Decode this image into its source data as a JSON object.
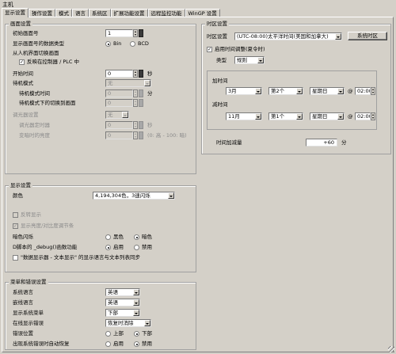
{
  "window_title": "主机",
  "tabs": [
    "显示设置",
    "操作设置",
    "模式",
    "语言",
    "系统区",
    "扩展功能设置",
    "远程监控功能",
    "WinGP 设置"
  ],
  "screen_settings": {
    "title": "画面设置",
    "initial_screen_label": "初始画面号",
    "initial_screen_value": "1",
    "data_type_label": "显示画面号的数据类型",
    "bin_label": "Bin",
    "bcd_label": "BCD",
    "data_type_selected": "Bin",
    "switch_from_hmi_label": "从人机界面切换画面",
    "reflect_label": "反映在控制器 / PLC 中",
    "reflect_checked": true,
    "start_time_label": "开始时间",
    "start_time_value": "0",
    "seconds_unit": "秒",
    "standby_label": "待机模式",
    "standby_value": "无",
    "standby_time_label": "待机模式时间",
    "standby_time_value": "0",
    "minutes_unit": "分",
    "standby_switch_label": "待机模式下的切换到画面",
    "standby_switch_value": "0",
    "dimmer_label": "调光器设置",
    "dimmer_value": "无",
    "dimmer_timer_label": "调光器定时器",
    "dimmer_timer_value": "0",
    "dimmer_brightness_label": "变暗时的亮度",
    "dimmer_brightness_value": "0",
    "brightness_range": "(0: 高 - 100: 暗)"
  },
  "display_settings": {
    "title": "显示设置",
    "color_label": "颜色",
    "color_value": "4,194,304色，3速闪烁",
    "reverse_label": "反转显示",
    "brightness_contrast_label": "显示亮度/对比度调节条",
    "dark_flash_label": "暗色闪烁",
    "black_label": "黑色",
    "dark_label": "暗色",
    "dark_flash_selected": "暗色",
    "debug_label": "D脚本的 _debug()函数功能",
    "enable_label": "启用",
    "disable_label": "禁用",
    "debug_selected": "启用",
    "sync_label": "\"数据显示器 - 文本显示\" 的显示语言与文本列表同步"
  },
  "menu_settings": {
    "title": "菜单和错误设置",
    "system_lang_label": "系统语言",
    "system_lang_value": "英语",
    "font_lang_label": "嵌线语言",
    "font_lang_value": "英语",
    "show_menu_label": "显示系统菜单",
    "show_menu_value": "下部",
    "online_error_label": "在线显示错误",
    "online_error_value": "恢复时消除",
    "error_pos_label": "错误位置",
    "top_label": "上部",
    "bottom_label": "下部",
    "error_pos_selected": "下部",
    "auto_recover_label": "出现系统错误时自动恢复",
    "auto_recover_selected": "禁用"
  },
  "time_zone": {
    "title": "时区设置",
    "zone_label": "时区设置",
    "zone_value": "(UTC-08:00)太平洋时间(美国和加拿大)",
    "zone_button": "系统时区",
    "dst_label": "启用时间调整(夏令时)",
    "dst_checked": true,
    "type_label": "类型",
    "type_value": "规则",
    "start_label": "加时间",
    "start_month": "3月",
    "start_week": "第2个",
    "start_day": "星期日",
    "start_time": "02:00",
    "end_label": "减时间",
    "end_month": "11月",
    "end_week": "第1个",
    "end_day": "星期日",
    "end_time": "02:00",
    "at_symbol": "@",
    "offset_label": "时间加减量",
    "offset_value": "+60",
    "offset_unit": "分"
  }
}
